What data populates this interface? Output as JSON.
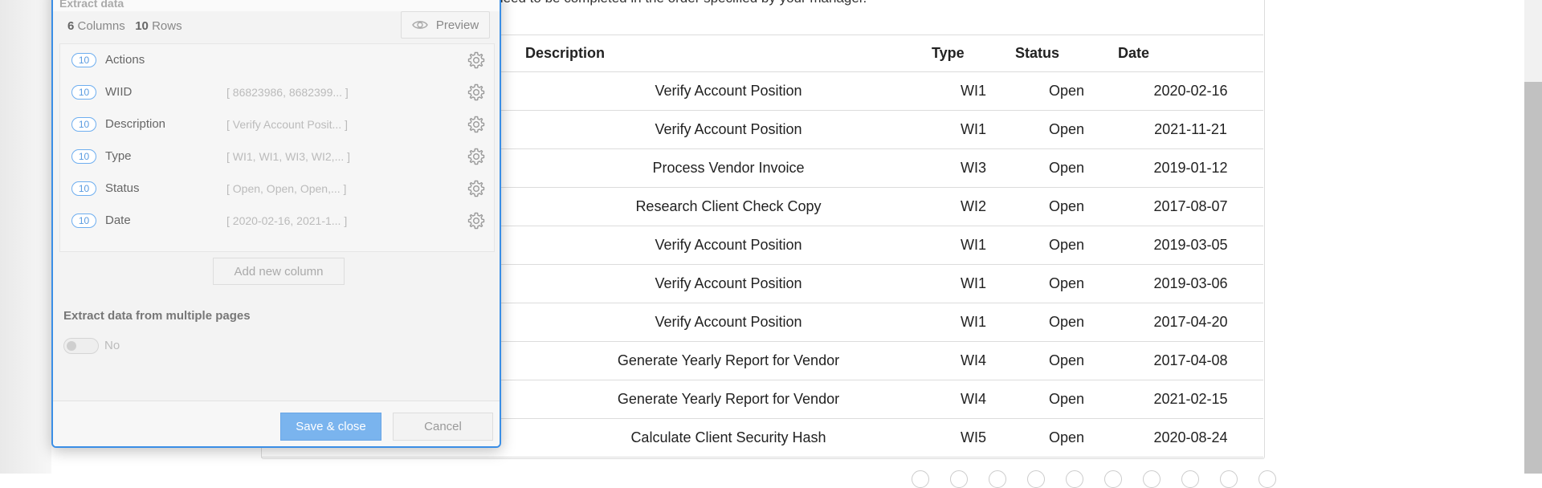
{
  "page": {
    "instructions": "ney need to be completed in the order specified by your manager.",
    "table": {
      "headers": [
        "",
        "Description",
        "Type",
        "Status",
        "Date"
      ],
      "rows": [
        {
          "description": "Verify Account Position",
          "type": "WI1",
          "status": "Open",
          "date": "2020-02-16"
        },
        {
          "description": "Verify Account Position",
          "type": "WI1",
          "status": "Open",
          "date": "2021-11-21"
        },
        {
          "description": "Process Vendor Invoice",
          "type": "WI3",
          "status": "Open",
          "date": "2019-01-12"
        },
        {
          "description": "Research Client Check Copy",
          "type": "WI2",
          "status": "Open",
          "date": "2017-08-07"
        },
        {
          "description": "Verify Account Position",
          "type": "WI1",
          "status": "Open",
          "date": "2019-03-05"
        },
        {
          "description": "Verify Account Position",
          "type": "WI1",
          "status": "Open",
          "date": "2019-03-06"
        },
        {
          "description": "Verify Account Position",
          "type": "WI1",
          "status": "Open",
          "date": "2017-04-20"
        },
        {
          "description": "Generate Yearly Report for Vendor",
          "type": "WI4",
          "status": "Open",
          "date": "2017-04-08"
        },
        {
          "description": "Generate Yearly Report for Vendor",
          "type": "WI4",
          "status": "Open",
          "date": "2021-02-15"
        },
        {
          "description": "Calculate Client Security Hash",
          "type": "WI5",
          "status": "Open",
          "date": "2020-08-24"
        }
      ]
    }
  },
  "dialog": {
    "title": "Extract data",
    "summary": {
      "columns_count": "6",
      "columns_label": "Columns",
      "rows_count": "10",
      "rows_label": "Rows"
    },
    "preview_label": "Preview",
    "columns": [
      {
        "count": "10",
        "name": "Actions",
        "preview": ""
      },
      {
        "count": "10",
        "name": "WIID",
        "preview": "[ 86823986, 8682399... ]"
      },
      {
        "count": "10",
        "name": "Description",
        "preview": "[ Verify Account Posit... ]"
      },
      {
        "count": "10",
        "name": "Type",
        "preview": "[ WI1, WI1, WI3, WI2,... ]"
      },
      {
        "count": "10",
        "name": "Status",
        "preview": "[ Open, Open, Open,... ]"
      },
      {
        "count": "10",
        "name": "Date",
        "preview": "[ 2020-02-16, 2021-1... ]"
      }
    ],
    "add_column_label": "Add new column",
    "multi_page_label": "Extract data from multiple pages",
    "multi_page_value": "No",
    "save_label": "Save & close",
    "cancel_label": "Cancel"
  },
  "colors": {
    "accent": "#3a8ee6",
    "save_button": "#7ab4ee",
    "badge": "#5a9be0"
  },
  "icons": [
    "eye-icon",
    "gear-icon"
  ]
}
